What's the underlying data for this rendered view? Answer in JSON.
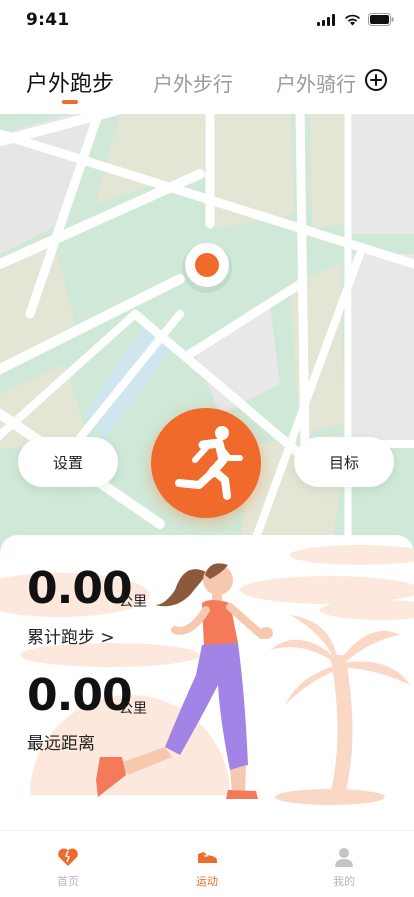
{
  "status": {
    "time": "9:41"
  },
  "tabs": [
    {
      "label": "户外跑步",
      "active": true
    },
    {
      "label": "户外步行",
      "active": false
    },
    {
      "label": "户外骑行",
      "active": false
    }
  ],
  "map": {
    "settings_label": "设置",
    "goal_label": "目标"
  },
  "stats": {
    "total": {
      "value": "0.00",
      "unit": "公里",
      "label": "累计跑步 >"
    },
    "recent": {
      "value": "0.00",
      "unit": "公里",
      "label": "最远距离"
    }
  },
  "nav": [
    {
      "label": "首页",
      "icon": "heart-icon",
      "active": false
    },
    {
      "label": "运动",
      "icon": "shoe-icon",
      "active": true
    },
    {
      "label": "我的",
      "icon": "person-icon",
      "active": false
    }
  ],
  "colors": {
    "accent": "#f06a2b",
    "map_green": "#cde8d6",
    "map_gray": "#ececec"
  }
}
